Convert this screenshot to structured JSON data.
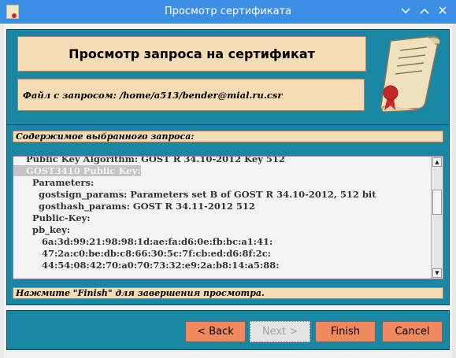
{
  "window": {
    "title": "Просмотр сертификата",
    "minimize_icon": "chevron-down-icon",
    "maximize_icon": "chevron-up-icon",
    "close_icon": "close-icon"
  },
  "header": {
    "title": "Просмотр запроса на сертификат",
    "file_line": "Файл с запросом: /home/a513/bender@mial.ru.csr",
    "art_icon": "certificate-scroll-icon"
  },
  "content": {
    "section_label": "Содержимое выбранного запроса:",
    "lines": [
      "    Public Key Algorithm: GOST R 34.10-2012 Key 512",
      "    GOST3410 Public Key:",
      "      Parameters:",
      "        gostsign_params: Parameters set B of GOST R 34.10-2012, 512 bit",
      "        gosthash_params: GOST R 34.11-2012 512",
      "      Public-Key:",
      "      pb_key:",
      "         6a:3d:99:21:98:98:1d:ae:fa:d6:0e:fb:bc:a1:41:",
      "         47:2a:c0:be:db:c8:66:30:5c:7f:cb:ed:d6:8f:2c:",
      "         44:54:08:42:70:a0:70:73:32:e9:2a:b8:14:a5:88:"
    ],
    "hint": "Нажмите \"Finish\" для завершения просмотра."
  },
  "buttons": {
    "back": "< Back",
    "next": "Next >",
    "finish": "Finish",
    "cancel": "Cancel"
  }
}
